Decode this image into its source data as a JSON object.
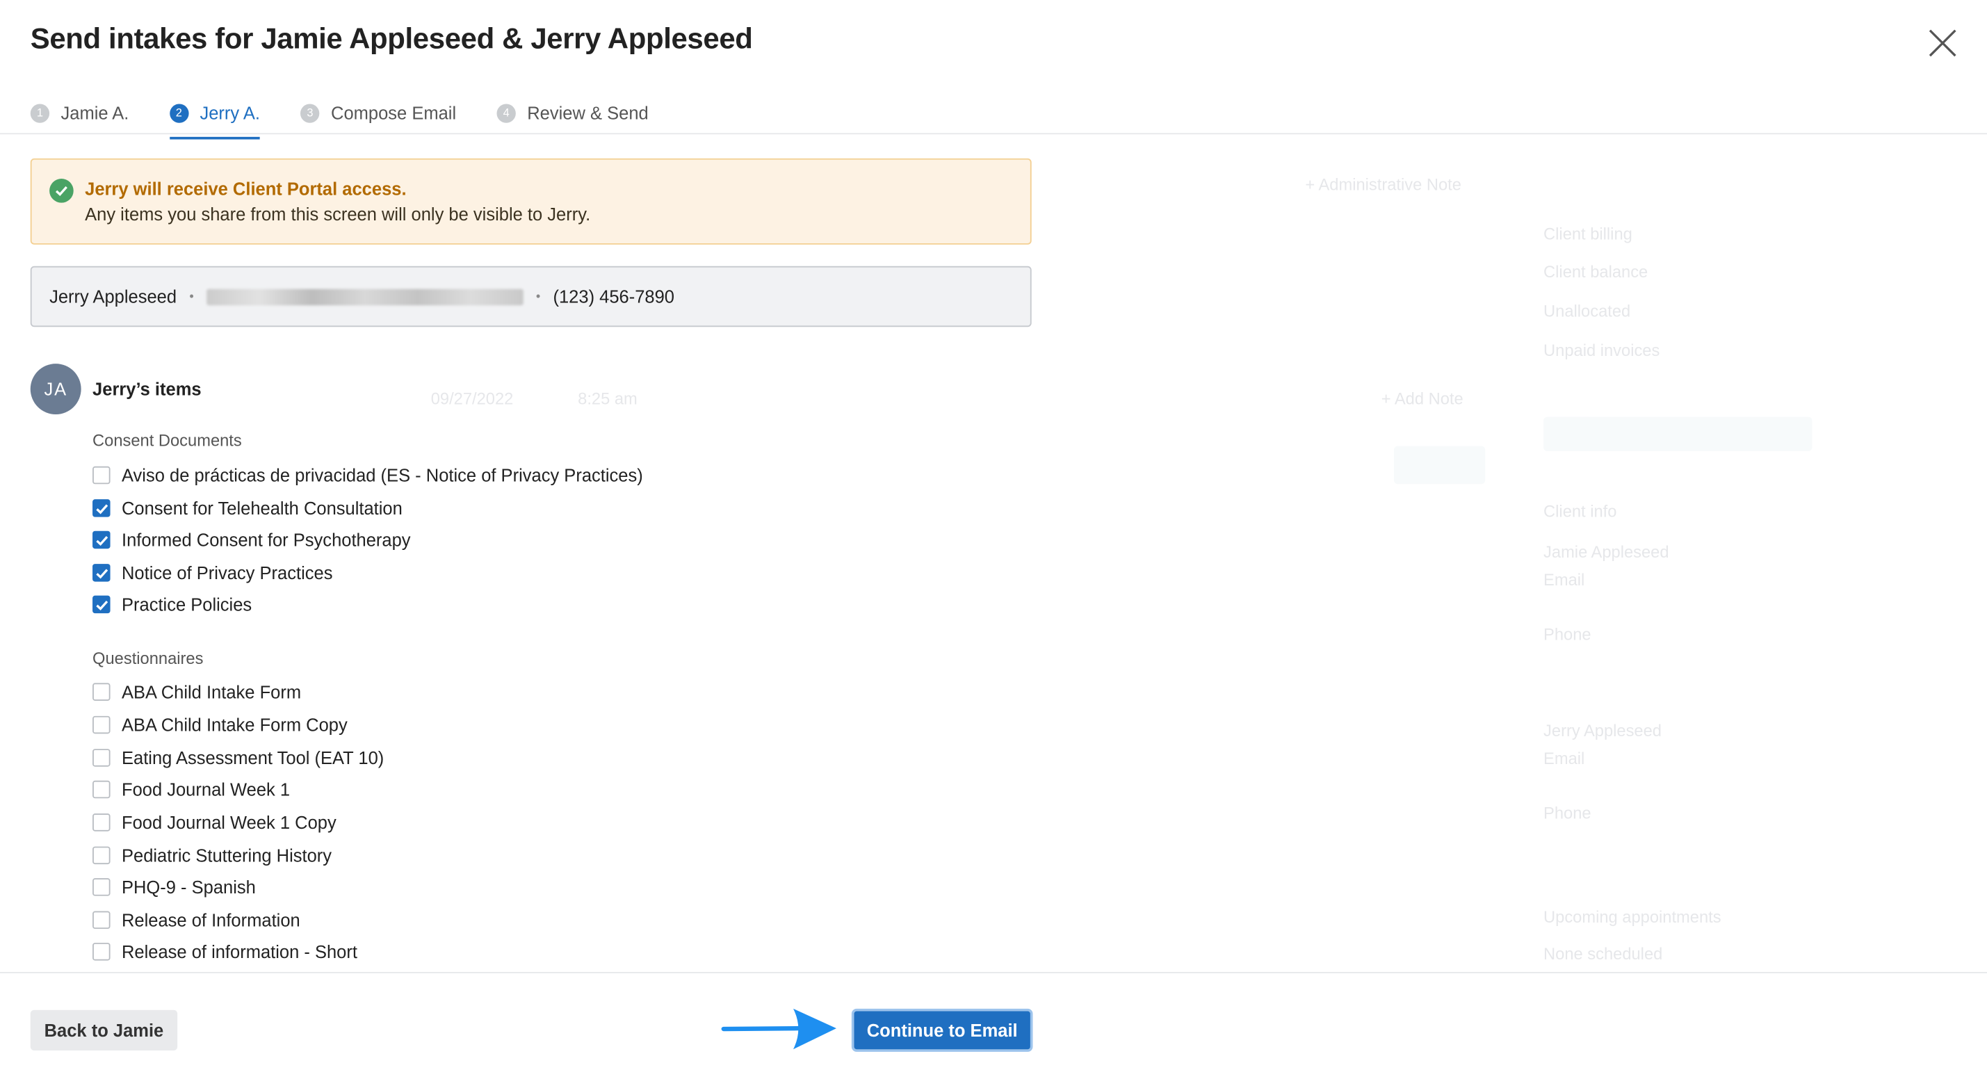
{
  "modal": {
    "title": "Send intakes for Jamie Appleseed & Jerry Appleseed",
    "close_icon": "close-icon"
  },
  "steps": [
    {
      "num": "1",
      "label": "Jamie A.",
      "active": false
    },
    {
      "num": "2",
      "label": "Jerry A.",
      "active": true
    },
    {
      "num": "3",
      "label": "Compose Email",
      "active": false
    },
    {
      "num": "4",
      "label": "Review & Send",
      "active": false
    }
  ],
  "alert": {
    "heading": "Jerry will receive Client Portal access.",
    "body": "Any items you share from this screen will only be visible to Jerry.",
    "icon": "check-circle-icon"
  },
  "client": {
    "name": "Jerry Appleseed",
    "separator": "•",
    "phone": "(123) 456-7890"
  },
  "items": {
    "avatar_initials": "JA",
    "title": "Jerry’s items",
    "consent_label": "Consent Documents",
    "consent_documents": [
      {
        "label": "Aviso de prácticas de privacidad (ES - Notice of Privacy Practices)",
        "checked": false
      },
      {
        "label": "Consent for Telehealth Consultation",
        "checked": true
      },
      {
        "label": "Informed Consent for Psychotherapy",
        "checked": true
      },
      {
        "label": "Notice of Privacy Practices",
        "checked": true
      },
      {
        "label": "Practice Policies",
        "checked": true
      }
    ],
    "questionnaires_label": "Questionnaires",
    "questionnaires": [
      {
        "label": "ABA Child Intake Form",
        "checked": false
      },
      {
        "label": "ABA Child Intake Form Copy",
        "checked": false
      },
      {
        "label": "Eating Assessment Tool (EAT 10)",
        "checked": false
      },
      {
        "label": "Food Journal Week 1",
        "checked": false
      },
      {
        "label": "Food Journal Week 1 Copy",
        "checked": false
      },
      {
        "label": "Pediatric Stuttering History",
        "checked": false
      },
      {
        "label": "PHQ-9 - Spanish",
        "checked": false
      },
      {
        "label": "Release of Information",
        "checked": false
      },
      {
        "label": "Release of information - Short",
        "checked": false
      }
    ]
  },
  "footer": {
    "back_label": "Back to Jamie",
    "continue_label": "Continue to Email"
  },
  "background": {
    "admin_note": "+ Administrative Note",
    "client_billing": "Client billing",
    "client_balance": "Client balance",
    "unallocated": "Unallocated",
    "unpaid_invoices": "Unpaid invoices",
    "date": "09/27/2022",
    "time": "8:25 am",
    "add_note": "+ Add Note",
    "client_info": "Client info",
    "jamie": "Jamie Appleseed",
    "jerry": "Jerry Appleseed",
    "email": "Email",
    "phone": "Phone",
    "upcoming": "Upcoming appointments",
    "none_scheduled": "None scheduled"
  },
  "colors": {
    "accent": "#1f6fc1",
    "alert_bg": "#fdf2e3",
    "alert_border": "#f3cf91",
    "alert_heading": "#b26a00",
    "success": "#4aa365",
    "avatar": "#6b7c93"
  }
}
